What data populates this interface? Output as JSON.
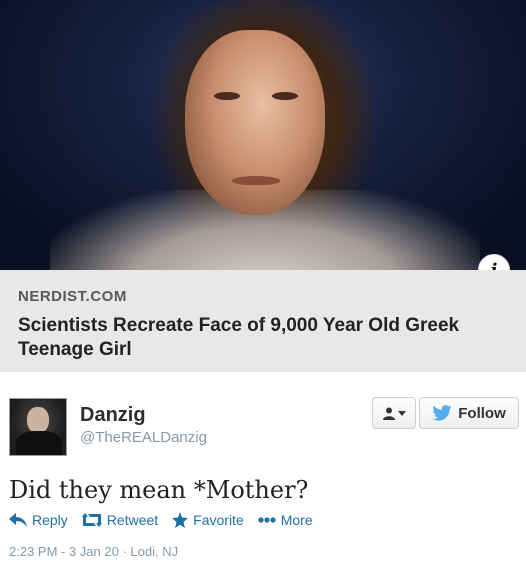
{
  "link_card": {
    "domain": "NERDIST.COM",
    "title": "Scientists Recreate Face of 9,000 Year Old Greek Teenage Girl",
    "info_icon": "i"
  },
  "tweet": {
    "author_name": "Danzig",
    "author_handle": "@TheREALDanzig",
    "follow_label": "Follow",
    "text": "Did they mean *Mother?",
    "actions": {
      "reply": "Reply",
      "retweet": "Retweet",
      "favorite": "Favorite",
      "more": "More"
    },
    "timestamp": "2:23 PM - 3 Jan 20 · Lodi, NJ"
  },
  "icons": {
    "info": "info-icon",
    "user": "user-icon",
    "bird": "twitter-bird-icon",
    "reply": "reply-arrow-icon",
    "retweet": "retweet-icon",
    "favorite": "star-icon",
    "more": "dots-icon"
  },
  "colors": {
    "link_blue": "#1d70a6",
    "caption_bg": "#e8e8e8",
    "muted_text": "#8899a6",
    "twitter_blue": "#55acee"
  }
}
